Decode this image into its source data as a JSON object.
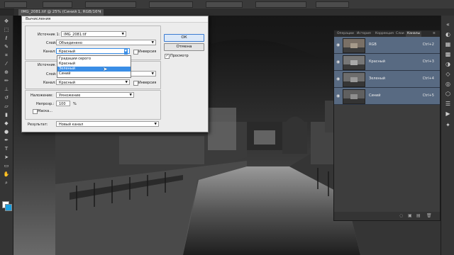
{
  "app": {
    "document_tab": "IMG_2081.tif @ 25% (Синий 1, RGB/16*)",
    "document_tab_close": "×"
  },
  "dialog": {
    "title": "Вычисления",
    "source1": {
      "label": "Источник 1:",
      "value": "IMG_2081.tif",
      "layer_label": "Слой:",
      "layer_value": "Объединено",
      "channel_label": "Канал:",
      "channel_value": "Красный",
      "invert_label": "Инверсия"
    },
    "source2": {
      "label": "Источник",
      "layer_label": "Слой:",
      "channel_label": "Канал:",
      "channel_value": "Красный",
      "invert_label": "Инверсия"
    },
    "blending": {
      "label": "Наложение:",
      "value": "Умножение",
      "opacity_label": "Непрозр.:",
      "opacity_value": "100",
      "opacity_unit": "%",
      "mask_label": "Маска..."
    },
    "result": {
      "label": "Результат:",
      "value": "Новый канал"
    },
    "buttons": {
      "ok": "ОК",
      "cancel": "Отмена",
      "preview": "Просмотр",
      "preview_checked": true
    },
    "channel_dropdown": {
      "options": [
        "Градации серого",
        "Красный",
        "Зеленый",
        "Синий"
      ],
      "highlighted": "Зеленый"
    }
  },
  "panel": {
    "tabs": [
      "Операции",
      "История",
      "Коррекция",
      "Слои",
      "Каналы"
    ],
    "active_tab": "Каналы",
    "channels": [
      {
        "name": "RGB",
        "shortcut": "Ctrl+2"
      },
      {
        "name": "Красный",
        "shortcut": "Ctrl+3"
      },
      {
        "name": "Зеленый",
        "shortcut": "Ctrl+4"
      },
      {
        "name": "Синий",
        "shortcut": "Ctrl+5"
      }
    ]
  },
  "colors": {
    "foreground": "#ffffff",
    "background": "#1a9fe0",
    "selected_channel_row": "#586a82",
    "dropdown_highlight": "#3a8ee6"
  }
}
